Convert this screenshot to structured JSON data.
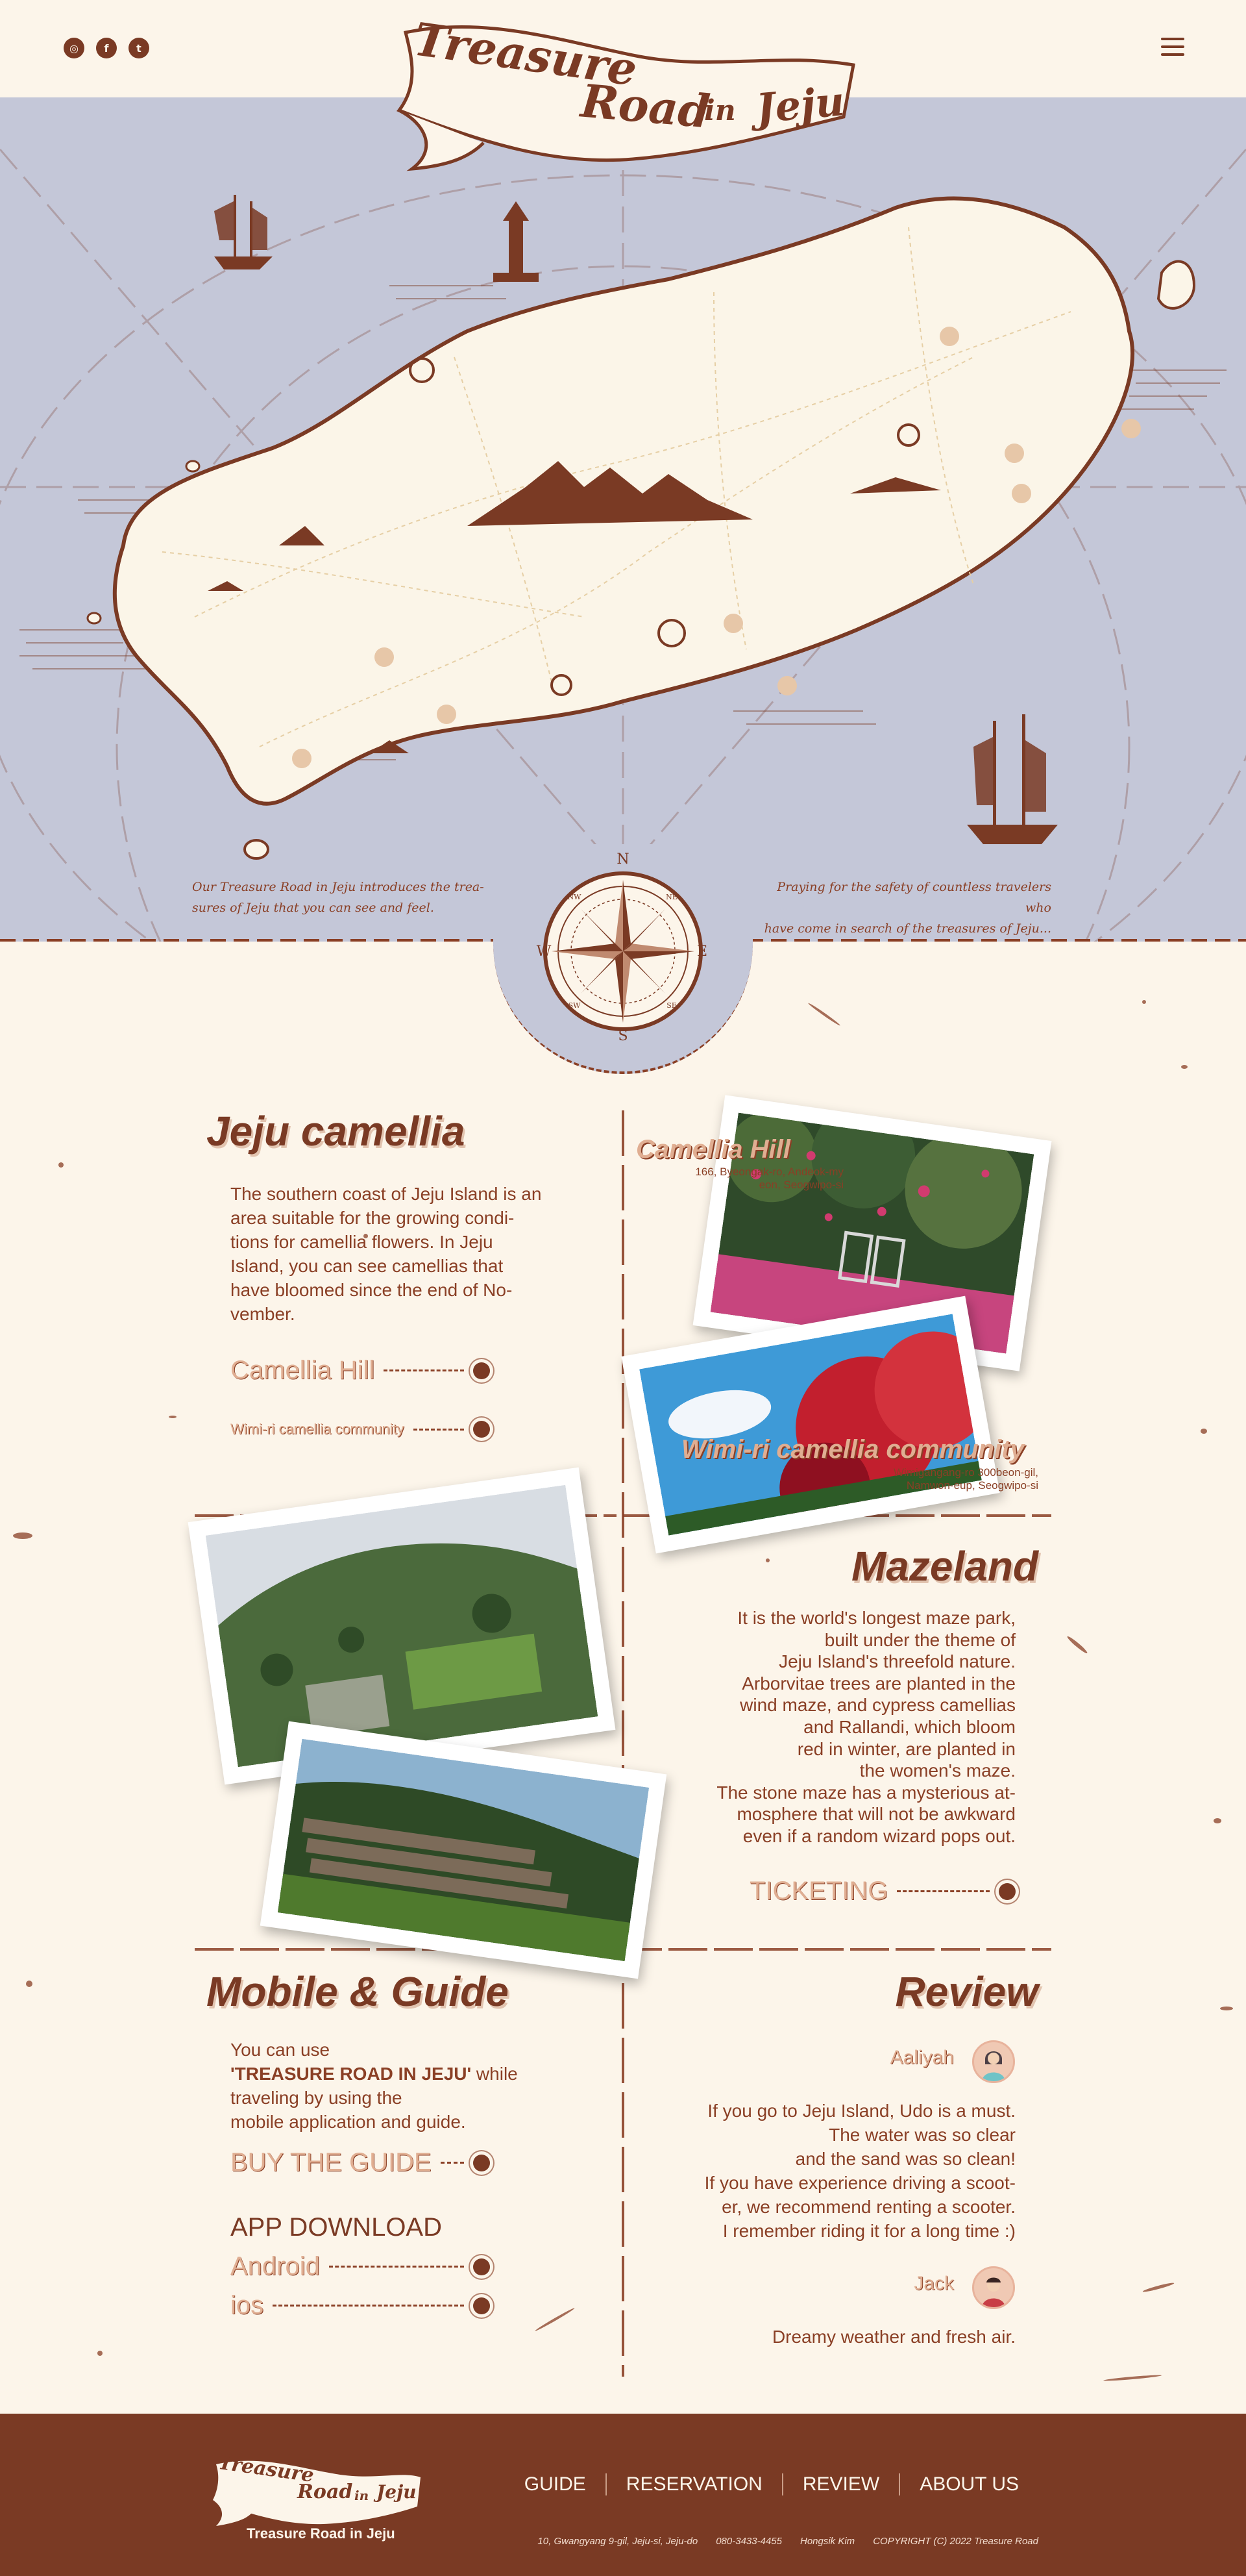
{
  "header": {
    "social": [
      {
        "icon": "instagram-icon",
        "glyph": "◎"
      },
      {
        "icon": "facebook-icon",
        "glyph": "f"
      },
      {
        "icon": "twitter-icon",
        "glyph": "t"
      }
    ],
    "logo": {
      "word1": "Treasure",
      "word2": "Road",
      "word3": "in",
      "word4": "Jeju"
    },
    "menu_icon": "hamburger-menu-icon"
  },
  "map": {
    "caption_left": [
      "Our Treasure Road in Jeju introduces the trea-",
      "sures of Jeju that you can see and feel."
    ],
    "caption_right": [
      "Praying for the safety of countless travelers who",
      "have come in search of the treasures of Jeju..."
    ],
    "compass": {
      "n": "N",
      "s": "S",
      "e": "E",
      "w": "W",
      "ne": "NE",
      "nw": "NW",
      "se": "SE",
      "sw": "SW"
    }
  },
  "camellia": {
    "title": "Jeju camellia",
    "text": [
      "The southern coast of Jeju Island is an",
      "area suitable for the growing condi-",
      "tions for camellia flowers. In Jeju",
      "Island, you can see camellias that",
      "have bloomed since the end of No-",
      "vember."
    ],
    "link1": "Camellia Hill",
    "link2": "Wimi-ri camellia community",
    "photo1": {
      "title": "Camellia Hill",
      "sub1": "166, Byeongak-ro, Andeok-my",
      "sub2": "eon, Seogwipo-si"
    },
    "photo2": {
      "title": "Wimi-ri camellia community",
      "sub1": "Wimigangang-ro 300beon-gil,",
      "sub2": "Namwon-eup, Seogwipo-si"
    }
  },
  "mazeland": {
    "title": "Mazeland",
    "text": [
      "It is the world's longest maze park,",
      "built under the theme of",
      "Jeju Island's threefold nature.",
      "Arborvitae trees are planted in the",
      "wind maze, and cypress camellias",
      "and Rallandi, which bloom",
      "red in winter, are planted in",
      "the women's maze.",
      "The stone maze has a mysterious at-",
      "mosphere that will not be awkward",
      "even if a random wizard pops out."
    ],
    "link": "TICKETING"
  },
  "mobile": {
    "title": "Mobile & Guide",
    "line1": "You can use",
    "highlight": "'TREASURE ROAD IN JEJU'",
    "line2_rest": " while",
    "line3": "traveling by using the",
    "line4": "mobile application and guide.",
    "guide_link": "BUY THE GUIDE",
    "app_title": "APP DOWNLOAD",
    "android": "Android",
    "ios": "ios"
  },
  "review": {
    "title": "Review",
    "items": [
      {
        "name": "Aaliyah",
        "avatar": "woman-avatar-icon",
        "text": [
          "If you go to Jeju Island, Udo is a must.",
          "The water was so clear",
          "and the sand was so clean!",
          "If you have experience driving a scoot-",
          "er, we recommend renting a scooter.",
          "I remember riding it for a long time :)"
        ]
      },
      {
        "name": "Jack",
        "avatar": "man-avatar-icon",
        "text": [
          "Dreamy weather and fresh air."
        ]
      }
    ]
  },
  "footer": {
    "logo": {
      "word1": "Treasure",
      "word2": "Road",
      "word3": "in",
      "word4": "Jeju",
      "subtitle": "Treasure Road in Jeju"
    },
    "nav": [
      "GUIDE",
      "RESERVATION",
      "REVIEW",
      "ABOUT US"
    ],
    "address": "10, Gwangyang 9-gil, Jeju-si, Jeju-do",
    "phone": "080-3433-4455",
    "owner": "Hongsik Kim",
    "copyright": "COPYRIGHT (C) 2022 Treasure Road"
  },
  "colors": {
    "brand": "#7a3a24",
    "paper": "#fcf5ea",
    "sea": "#c4c7d8",
    "accent": "#e0ae92"
  }
}
